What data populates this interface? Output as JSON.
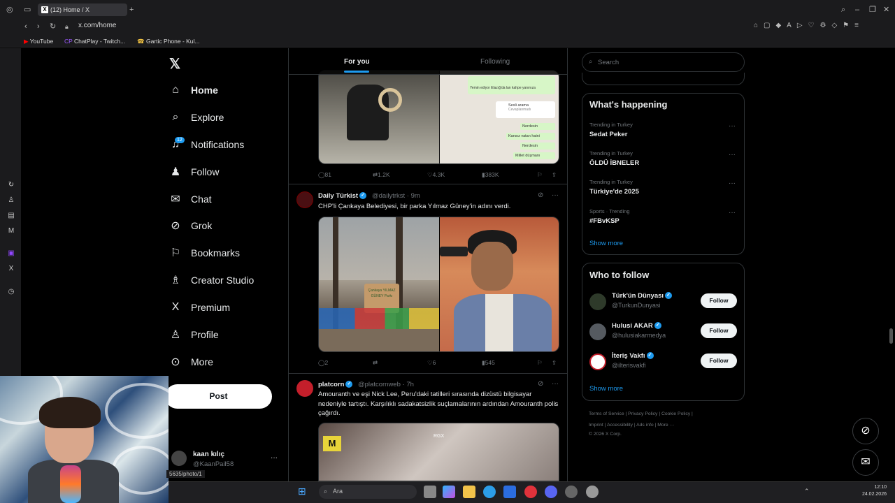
{
  "browser": {
    "tab_title": "(12) Home / X",
    "url": "x.com/home",
    "bookmarks": [
      "YouTube",
      "ChatPlay - Twitch...",
      "Gartic Phone - Kul..."
    ],
    "status_url": "5635/photo/1"
  },
  "nav": {
    "items": [
      {
        "label": "Home",
        "icon": "home-icon"
      },
      {
        "label": "Explore",
        "icon": "search-icon"
      },
      {
        "label": "Notifications",
        "icon": "bell-icon"
      },
      {
        "label": "Follow",
        "icon": "add-person-icon"
      },
      {
        "label": "Chat",
        "icon": "mail-icon"
      },
      {
        "label": "Grok",
        "icon": "grok-icon"
      },
      {
        "label": "Bookmarks",
        "icon": "bookmark-icon"
      },
      {
        "label": "Creator Studio",
        "icon": "creator-icon"
      },
      {
        "label": "Premium",
        "icon": "x-logo-icon"
      },
      {
        "label": "Profile",
        "icon": "person-icon"
      },
      {
        "label": "More",
        "icon": "more-circle-icon"
      }
    ],
    "notification_count": "12",
    "post_label": "Post"
  },
  "user": {
    "name": "kaan kılıç",
    "handle": "@KaanPail58"
  },
  "feed": {
    "tabs": [
      "For you",
      "Following"
    ],
    "tweet1_actions": {
      "replies": "81",
      "reposts": "1.2K",
      "likes": "4.3K",
      "views": "383K"
    },
    "tweet1_chat": [
      "Yemin ediyor Elazığ'da lan kahpe yanınıza",
      "Sesli arama",
      "Cevaplanmadı",
      "Nerdesin",
      "Kansız vatan haini",
      "Nerdesin",
      "Millet düşmanı"
    ],
    "tweet2": {
      "name": "Daily Türkist",
      "handle": "@dailytrkst",
      "time": "· 9m",
      "text": "CHP'li Çankaya Belediyesi, bir parka Yılmaz Güney'in adını verdi.",
      "sign_text": "Çankaya YILMAZ GÜNEY Parkı",
      "actions": {
        "replies": "2",
        "reposts": "",
        "likes": "6",
        "views": "545"
      }
    },
    "tweet3": {
      "name": "platcorn",
      "handle": "@platcornweb",
      "time": "· 7h",
      "text": "Amouranth ve eşi Nick Lee, Peru'daki tatilleri sırasında dizüstü bilgisayar nedeniyle tartıştı. Karşılıklı sadakatsizlik suçlamalarının ardından Amouranth polis çağırdı.",
      "media_label": "RGX"
    }
  },
  "sidebar": {
    "search_placeholder": "Search",
    "whats_happening": "What's happening",
    "trends": [
      {
        "meta": "Trending in Turkey",
        "name": "Sedat Peker"
      },
      {
        "meta": "Trending in Turkey",
        "name": "ÖLDÜ İBNELER"
      },
      {
        "meta": "Trending in Turkey",
        "name": "Türkiye'de 2025"
      },
      {
        "meta": "Sports · Trending",
        "name": "#FBvKSP"
      }
    ],
    "show_more": "Show more",
    "who_to_follow": "Who to follow",
    "suggestions": [
      {
        "name": "Türk'ün Dünyası",
        "handle": "@TurkunDunyasi",
        "button": "Follow"
      },
      {
        "name": "Hulusi AKAR",
        "handle": "@hulusiakarmedya",
        "button": "Follow"
      },
      {
        "name": "İteriş Vakfı",
        "handle": "@ilterisvakfi",
        "button": "Follow"
      }
    ],
    "footer_line1": "Terms of Service  |  Privacy Policy  |  Cookie Policy  |",
    "footer_line2": "Imprint  |  Accessibility  |  Ads info  |  More ···",
    "footer_line3": "© 2026 X Corp."
  },
  "taskbar": {
    "search_label": "Ara",
    "time": "12:10",
    "date": "24.02.2026"
  }
}
